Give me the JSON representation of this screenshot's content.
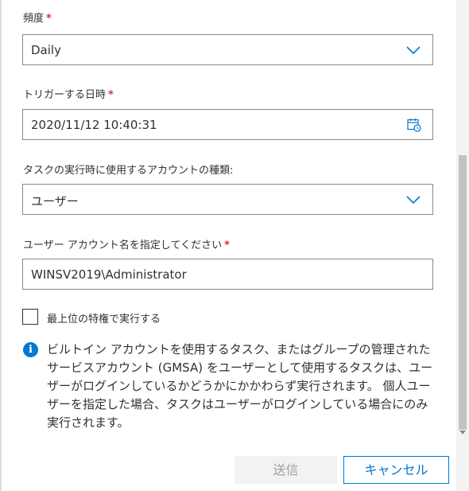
{
  "form": {
    "frequency": {
      "label": "頻度",
      "required": "*",
      "value": "Daily"
    },
    "trigger_datetime": {
      "label": "トリガーする日時",
      "required": "*",
      "value": "2020/11/12 10:40:31"
    },
    "account_type": {
      "label": "タスクの実行時に使用するアカウントの種類:",
      "value": "ユーザー"
    },
    "account_name": {
      "label": "ユーザー アカウント名を指定してください",
      "required": "*",
      "value": "WINSV2019\\Administrator"
    },
    "highest_privileges": {
      "label": "最上位の特権で実行する",
      "checked": false
    },
    "info": {
      "icon": "info-icon",
      "text": "ビルトイン アカウントを使用するタスク、またはグループの管理されたサービスアカウント (GMSA) をユーザーとして使用するタスクは、ユーザーがログインしているかどうかにかかわらず実行されます。 個人ユーザーを指定した場合、タスクはユーザーがログインしている場合にのみ実行されます。"
    }
  },
  "buttons": {
    "submit_label": "送信",
    "cancel_label": "キャンセル"
  },
  "colors": {
    "accent": "#0078d4",
    "required": "#d13438",
    "disabled_bg": "#f3f2f1",
    "disabled_text": "#a19f9d"
  }
}
